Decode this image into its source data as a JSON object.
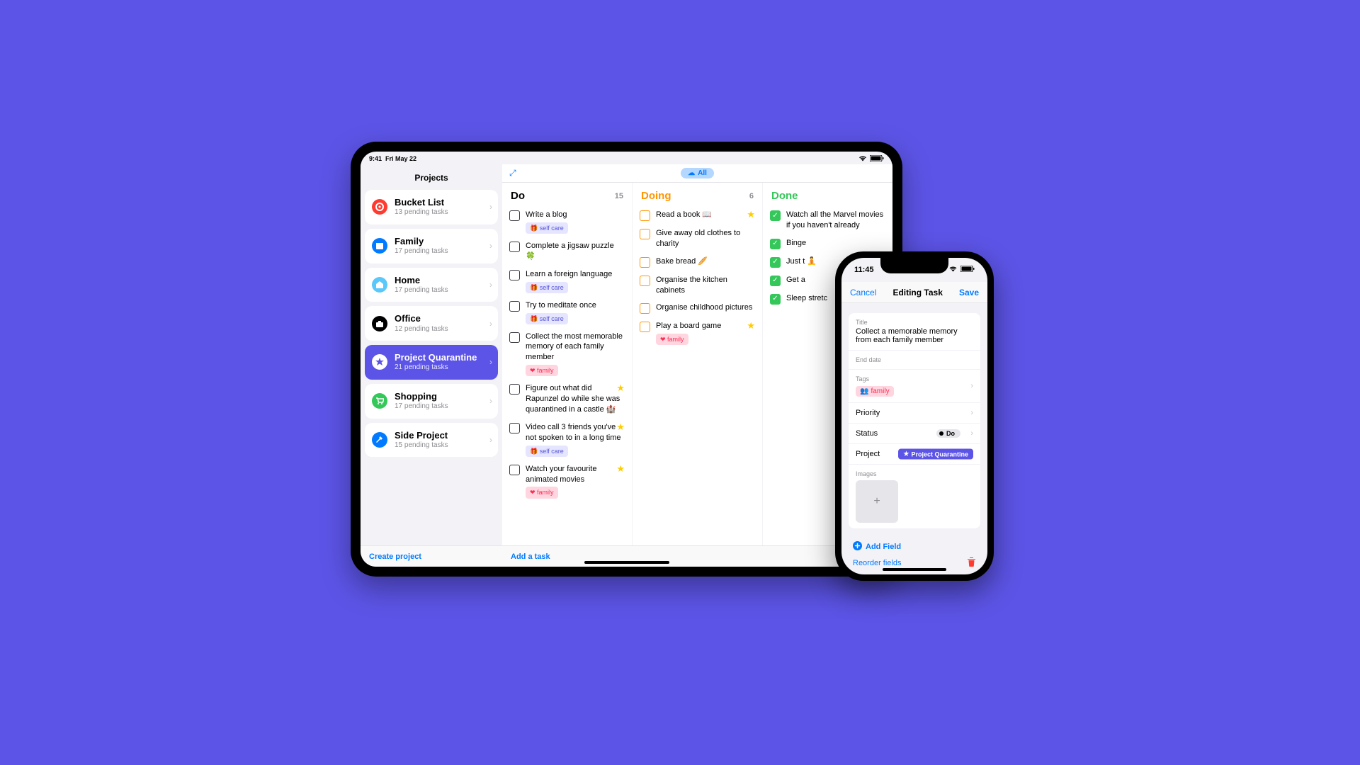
{
  "ipad": {
    "status_time": "9:41",
    "status_date": "Fri May 22",
    "sidebar_title": "Projects",
    "create_project": "Create project",
    "add_task": "Add a task",
    "all_pill": "All",
    "projects": [
      {
        "name": "Bucket List",
        "sub": "13 pending tasks",
        "color": "#ff3b30",
        "icon": "target"
      },
      {
        "name": "Family",
        "sub": "17 pending tasks",
        "color": "#007aff",
        "icon": "calendar"
      },
      {
        "name": "Home",
        "sub": "17 pending tasks",
        "color": "#5ac8fa",
        "icon": "home"
      },
      {
        "name": "Office",
        "sub": "12 pending tasks",
        "color": "#000",
        "icon": "briefcase"
      },
      {
        "name": "Project Quarantine",
        "sub": "21 pending tasks",
        "color": "#fff",
        "icon": "star",
        "active": true
      },
      {
        "name": "Shopping",
        "sub": "17 pending tasks",
        "color": "#34c759",
        "icon": "cart"
      },
      {
        "name": "Side Project",
        "sub": "15 pending tasks",
        "color": "#007aff",
        "icon": "hammer"
      }
    ],
    "columns": {
      "do": {
        "title": "Do",
        "count": "15",
        "color": "#000"
      },
      "doing": {
        "title": "Doing",
        "count": "6",
        "color": "#ff9500"
      },
      "done": {
        "title": "Done",
        "count": "",
        "color": "#34c759"
      }
    },
    "do_tasks": [
      {
        "text": "Write a blog",
        "tag": "selfcare"
      },
      {
        "text": "Complete a jigsaw puzzle 🍀"
      },
      {
        "text": "Learn a foreign language",
        "tag": "selfcare"
      },
      {
        "text": "Try to meditate once",
        "tag": "selfcare"
      },
      {
        "text": "Collect the most memorable memory of each family member",
        "tag": "family"
      },
      {
        "text": "Figure out what did Rapunzel do while she was quarantined in a castle 🏰",
        "star": true
      },
      {
        "text": "Video call 3 friends you've not spoken to in a long time",
        "tag": "selfcare",
        "star": true
      },
      {
        "text": "Watch your favourite animated movies",
        "tag": "family",
        "star": true
      }
    ],
    "doing_tasks": [
      {
        "text": "Read a book 📖",
        "star": true
      },
      {
        "text": "Give away old clothes to charity"
      },
      {
        "text": "Bake bread 🥖"
      },
      {
        "text": "Organise the kitchen cabinets"
      },
      {
        "text": "Organise childhood pictures"
      },
      {
        "text": "Play a board game",
        "tag": "family",
        "star": true
      }
    ],
    "done_tasks": [
      {
        "text": "Watch all the Marvel movies if you haven't already"
      },
      {
        "text": "Binge"
      },
      {
        "text": "Just t 🧘"
      },
      {
        "text": "Get a"
      },
      {
        "text": "Sleep stretc"
      }
    ],
    "tags": {
      "selfcare": "self care",
      "family": "family"
    }
  },
  "iphone": {
    "time": "11:45",
    "cancel": "Cancel",
    "title": "Editing Task",
    "save": "Save",
    "fields": {
      "title_label": "Title",
      "title_value": "Collect a memorable memory from each family member",
      "enddate_label": "End date",
      "tags_label": "Tags",
      "tags_value": "family",
      "priority_label": "Priority",
      "status_label": "Status",
      "status_value": "Do",
      "project_label": "Project",
      "project_value": "Project Quarantine",
      "images_label": "Images"
    },
    "add_field": "Add Field",
    "reorder": "Reorder fields"
  }
}
